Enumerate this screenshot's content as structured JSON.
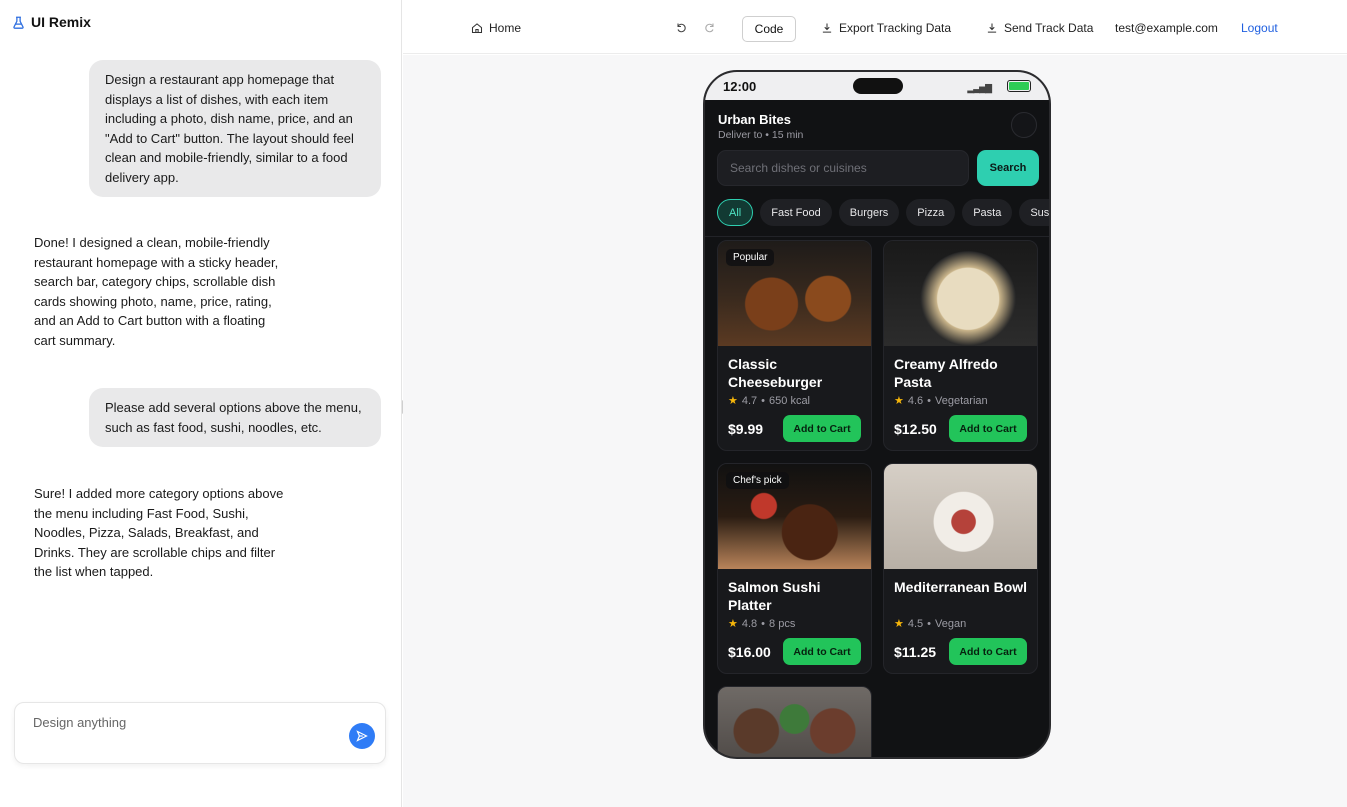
{
  "app": {
    "brand": "UI Remix"
  },
  "chat": {
    "messages": [
      {
        "role": "user",
        "text": "Design a restaurant app homepage that displays a list of dishes, with each item including a photo, dish name, price, and an \"Add to Cart\" button. The layout should feel clean and mobile-friendly, similar to a food delivery app."
      },
      {
        "role": "assistant",
        "text": "Done! I designed a clean, mobile-friendly restaurant homepage with a sticky header, search bar, category chips, scrollable dish cards showing photo, name, price, rating, and an Add to Cart button with a floating cart summary."
      },
      {
        "role": "user",
        "text": "Please add several options above the menu, such as fast food, sushi, noodles, etc."
      },
      {
        "role": "assistant",
        "text": "Sure! I added more category options above the menu including Fast Food, Sushi, Noodles, Pizza, Salads, Breakfast, and Drinks. They are scrollable chips and filter the list when tapped."
      }
    ],
    "composer_placeholder": "Design anything"
  },
  "toolbar": {
    "home": "Home",
    "code": "Code",
    "export": "Export Tracking Data",
    "send": "Send Track Data",
    "user_email": "test@example.com",
    "logout": "Logout"
  },
  "phone": {
    "status_time": "12:00",
    "restaurant_name": "Urban Bites",
    "delivery_info": "Deliver to • 15 min",
    "search_placeholder": "Search dishes or cuisines",
    "search_button": "Search",
    "categories": [
      {
        "label": "All",
        "active": true
      },
      {
        "label": "Fast Food",
        "active": false
      },
      {
        "label": "Burgers",
        "active": false
      },
      {
        "label": "Pizza",
        "active": false
      },
      {
        "label": "Pasta",
        "active": false
      },
      {
        "label": "Sushi",
        "active": false
      }
    ],
    "dishes": [
      {
        "name": "Classic Cheeseburger",
        "tag": "Popular",
        "rating": "4.7",
        "detail": "650 kcal",
        "price": "$9.99",
        "button": "Add to Cart"
      },
      {
        "name": "Creamy Alfredo Pasta",
        "tag": "",
        "rating": "4.6",
        "detail": "Vegetarian",
        "price": "$12.50",
        "button": "Add to Cart"
      },
      {
        "name": "Salmon Sushi Platter",
        "tag": "Chef's pick",
        "rating": "4.8",
        "detail": "8 pcs",
        "price": "$16.00",
        "button": "Add to Cart"
      },
      {
        "name": "Mediterranean Bowl",
        "tag": "",
        "rating": "4.5",
        "detail": "Vegan",
        "price": "$11.25",
        "button": "Add to Cart"
      }
    ]
  },
  "colors": {
    "accent": "#2ecfb0",
    "cart_green": "#22c45a",
    "send_blue": "#2f7cf6",
    "logout_blue": "#2060e0"
  },
  "icons": {
    "brand": "flask-icon",
    "home": "home-icon",
    "undo": "undo-icon",
    "redo": "redo-icon",
    "export": "download-icon",
    "send": "download-icon",
    "send_message": "send-icon"
  }
}
